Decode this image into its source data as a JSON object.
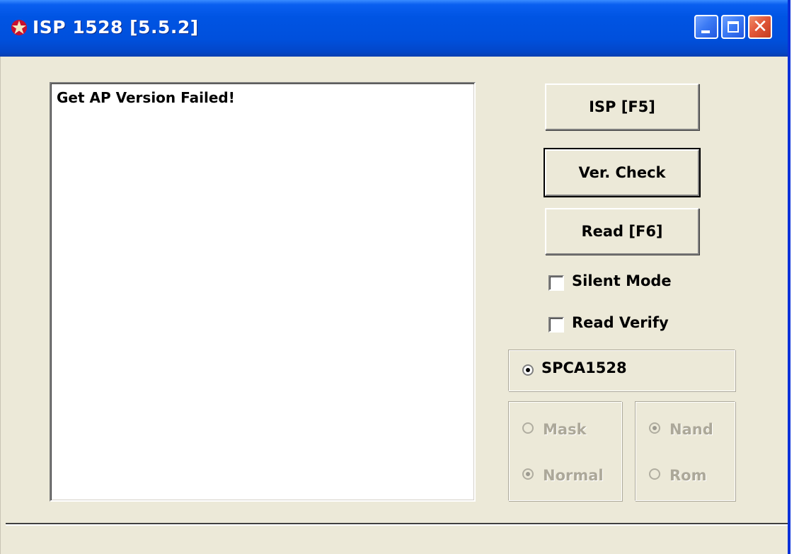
{
  "window": {
    "title": "ISP 1528 [5.5.2]",
    "title_icon": "app-star-icon",
    "controls": {
      "minimize_icon": "minimize-icon",
      "maximize_icon": "maximize-icon",
      "close_icon": "close-icon",
      "close_glyph": "✕"
    }
  },
  "log": {
    "lines": [
      "Get AP Version Failed!"
    ]
  },
  "buttons": {
    "isp": "ISP [F5]",
    "ver_check": "Ver. Check",
    "read": "Read [F6]"
  },
  "checkboxes": {
    "silent_mode": {
      "label": "Silent Mode",
      "checked": false
    },
    "read_verify": {
      "label": "Read Verify",
      "checked": false
    }
  },
  "chip": {
    "label": "SPCA1528",
    "selected": true
  },
  "mode_group": {
    "options": [
      {
        "label": "Mask",
        "selected": false,
        "enabled": false
      },
      {
        "label": "Normal",
        "selected": true,
        "enabled": false
      }
    ]
  },
  "type_group": {
    "options": [
      {
        "label": "Nand",
        "selected": true,
        "enabled": false
      },
      {
        "label": "Rom",
        "selected": false,
        "enabled": false
      }
    ]
  },
  "status_bar": {
    "text": ""
  },
  "colors": {
    "titlebar": "#0054E3",
    "window_bg": "#ECE9D8",
    "close_button": "#E2583A"
  }
}
